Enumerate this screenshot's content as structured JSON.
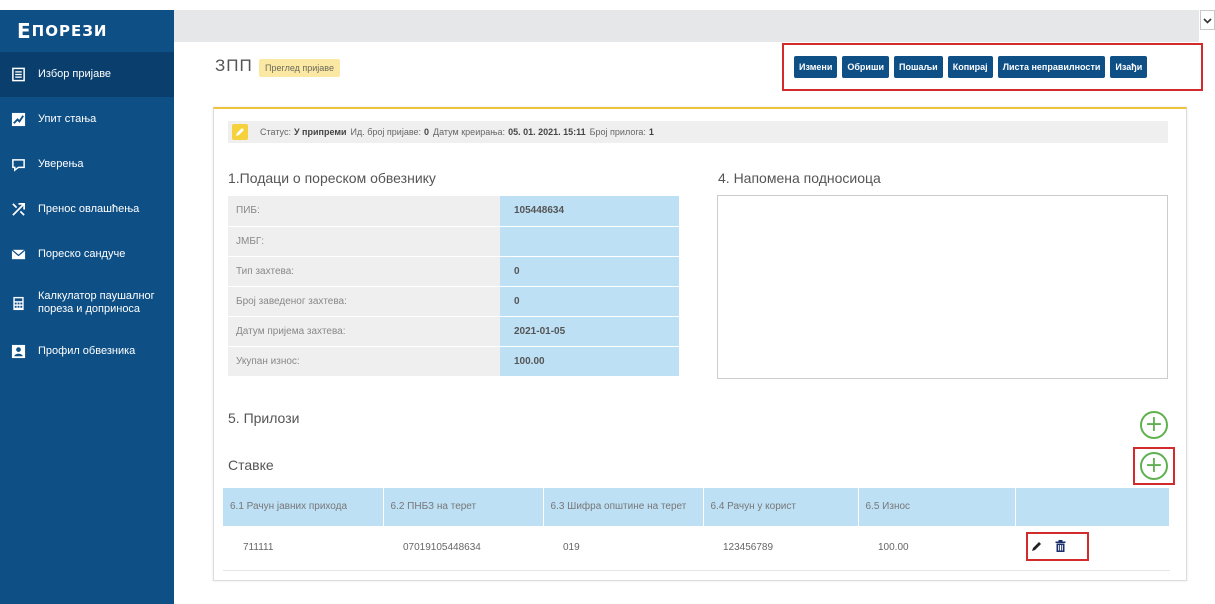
{
  "brand": {
    "first": "Е",
    "rest": "ПОРЕЗИ"
  },
  "sidebar": {
    "items": [
      {
        "label": "Избор пријаве",
        "icon": "list-icon",
        "active": true
      },
      {
        "label": "Упит стања",
        "icon": "chart-icon"
      },
      {
        "label": "Уверења",
        "icon": "certificate-icon"
      },
      {
        "label": "Пренос овлашћења",
        "icon": "transfer-icon"
      },
      {
        "label": "Пореско сандуче",
        "icon": "mail-icon"
      },
      {
        "label": "Калкулатор паушалног пореза и доприноса",
        "icon": "calculator-icon"
      },
      {
        "label": "Профил обвезника",
        "icon": "profile-icon"
      }
    ]
  },
  "header": {
    "title": "ЗПП",
    "badge": "Преглед пријаве"
  },
  "toolbar": {
    "buttons": [
      "Измени",
      "Обриши",
      "Пошаљи",
      "Копирај",
      "Листа неправилности",
      "Изађи"
    ]
  },
  "status": {
    "status_label": "Статус:",
    "status_value": "У припреми",
    "id_label": "Ид. број пријаве:",
    "id_value": "0",
    "date_label": "Датум креирања:",
    "date_value": "05. 01. 2021. 15:11",
    "attach_label": "Број прилога:",
    "attach_value": "1"
  },
  "section1": {
    "title": "1.Подаци о пореском обвезнику",
    "fields": [
      {
        "label": "ПИБ:",
        "value": "105448634"
      },
      {
        "label": "ЈМБГ:",
        "value": ""
      },
      {
        "label": "Тип захтева:",
        "value": "0"
      },
      {
        "label": "Број заведеног захтева:",
        "value": "0"
      },
      {
        "label": "Датум пријема захтева:",
        "value": "2021-01-05"
      },
      {
        "label": "Укупан износ:",
        "value": "100.00"
      }
    ]
  },
  "section4": {
    "title": "4. Напомена подносиоца",
    "value": ""
  },
  "section5": {
    "title": "5. Прилози"
  },
  "items": {
    "title": "Ставке",
    "columns": [
      "6.1 Рачун јавних прихода",
      "6.2 ПНБЗ на терет",
      "6.3 Шифра општине на терет",
      "6.4 Рачун у корист",
      "6.5 Износ",
      ""
    ],
    "rows": [
      [
        "711111",
        "07019105448634",
        "019",
        "123456789",
        "100.00"
      ]
    ]
  },
  "colors": {
    "sidebar": "#0e4f86",
    "sidebar_active": "#0a3f6d",
    "button": "#0e4f86",
    "highlight": "#bde0f5",
    "accent_yellow": "#f0c33c",
    "add_green": "#5fb14f",
    "frame_red": "#d12b2b"
  }
}
